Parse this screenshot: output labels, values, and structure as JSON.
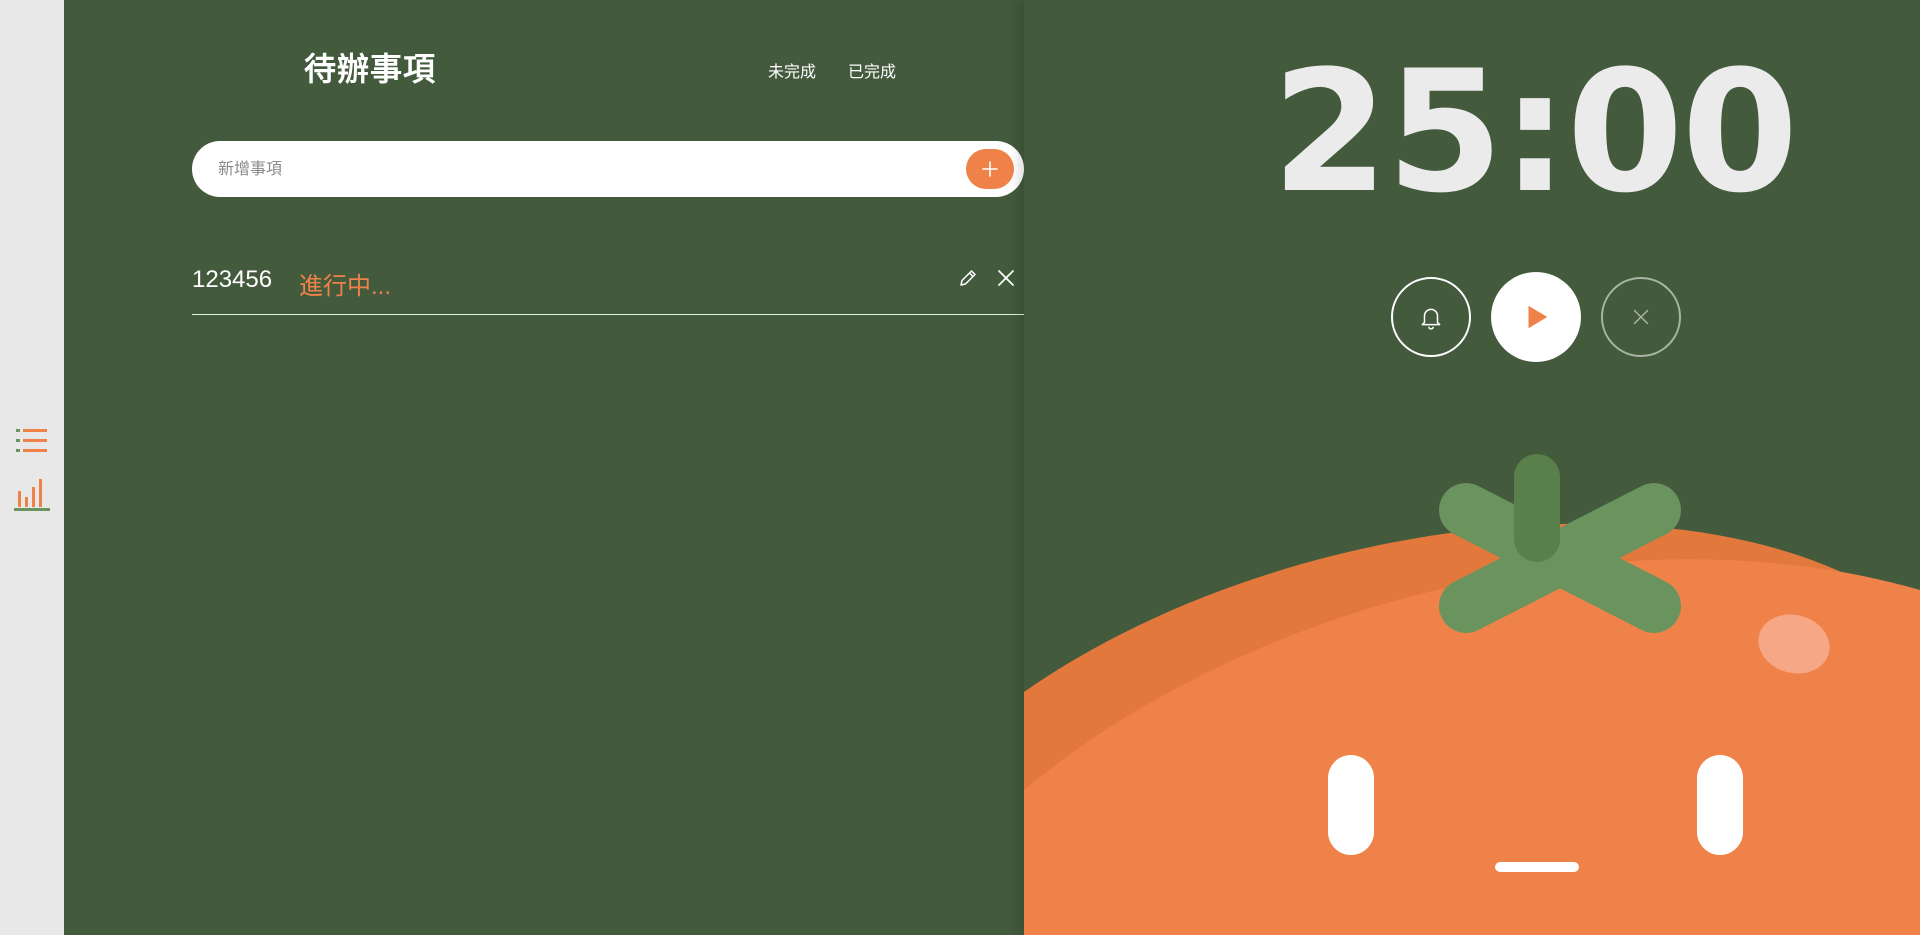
{
  "sidebar": {
    "items": [
      {
        "icon": "list-icon"
      },
      {
        "icon": "bar-chart-icon"
      }
    ]
  },
  "todo": {
    "title": "待辦事項",
    "tabs": [
      {
        "label": "未完成"
      },
      {
        "label": "已完成"
      }
    ],
    "input": {
      "placeholder": "新增事項",
      "value": ""
    },
    "add_icon": "plus-icon",
    "items": [
      {
        "name": "123456",
        "status": "進行中..."
      }
    ]
  },
  "timer": {
    "time": "25:00",
    "controls": [
      {
        "icon": "bell-icon"
      },
      {
        "icon": "play-icon"
      },
      {
        "icon": "close-icon"
      }
    ]
  },
  "colors": {
    "accent": "#ef8249",
    "background": "#435a3c",
    "rail": "#e8e8e8",
    "leaf": "#6b935d",
    "white": "#ffffff"
  }
}
